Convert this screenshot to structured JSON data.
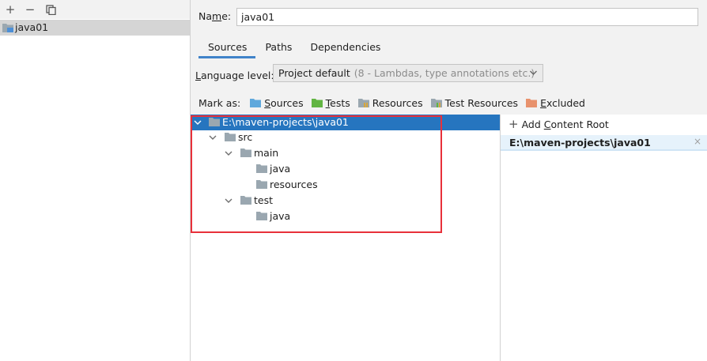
{
  "toolbar": {
    "add_icon": "+",
    "remove_icon": "−",
    "copy_icon": "copy-icon"
  },
  "modules": [
    {
      "label": "java01",
      "icon": "module-folder-icon"
    }
  ],
  "name_field": {
    "label_prefix": "Na",
    "label_mnemonic": "m",
    "label_suffix": "e:",
    "value": "java01"
  },
  "tabs": [
    {
      "label": "Sources",
      "active": true
    },
    {
      "label": "Paths",
      "active": false
    },
    {
      "label": "Dependencies",
      "active": false
    }
  ],
  "language_level": {
    "label_mnemonic": "L",
    "label_rest": "anguage level:",
    "value": "Project default",
    "hint": "(8 - Lambdas, type annotations etc.)"
  },
  "mark_as": {
    "label": "Mark as:",
    "items": [
      {
        "mnemonic": "S",
        "rest": "ources",
        "color": "#5fa8dc"
      },
      {
        "mnemonic": "T",
        "rest": "ests",
        "color": "#62b543"
      },
      {
        "mnemonic": "",
        "rest": "Resources",
        "color": "#9aa7b0"
      },
      {
        "mnemonic": "",
        "rest": "Test Resources",
        "color": "#9aa7b0"
      },
      {
        "mnemonic": "E",
        "rest": "xcluded",
        "color": "#e8926d"
      }
    ]
  },
  "tree": [
    {
      "label": "E:\\maven-projects\\java01",
      "depth": 0,
      "expanded": true,
      "selected": true
    },
    {
      "label": "src",
      "depth": 1,
      "expanded": true,
      "selected": false
    },
    {
      "label": "main",
      "depth": 2,
      "expanded": true,
      "selected": false
    },
    {
      "label": "java",
      "depth": 3,
      "expanded": false,
      "selected": false
    },
    {
      "label": "resources",
      "depth": 3,
      "expanded": false,
      "selected": false
    },
    {
      "label": "test",
      "depth": 2,
      "expanded": true,
      "selected": false
    },
    {
      "label": "java",
      "depth": 3,
      "expanded": false,
      "selected": false
    }
  ],
  "content_roots": {
    "add_prefix": "Add ",
    "add_mnemonic": "C",
    "add_rest": "ontent Root",
    "items": [
      {
        "path": "E:\\maven-projects\\java01",
        "close": "×"
      }
    ]
  },
  "colors": {
    "selection": "#2675bf",
    "tab_accent": "#4083c9",
    "highlight_box": "#e8303a",
    "folder_gray": "#9aa7b0"
  }
}
